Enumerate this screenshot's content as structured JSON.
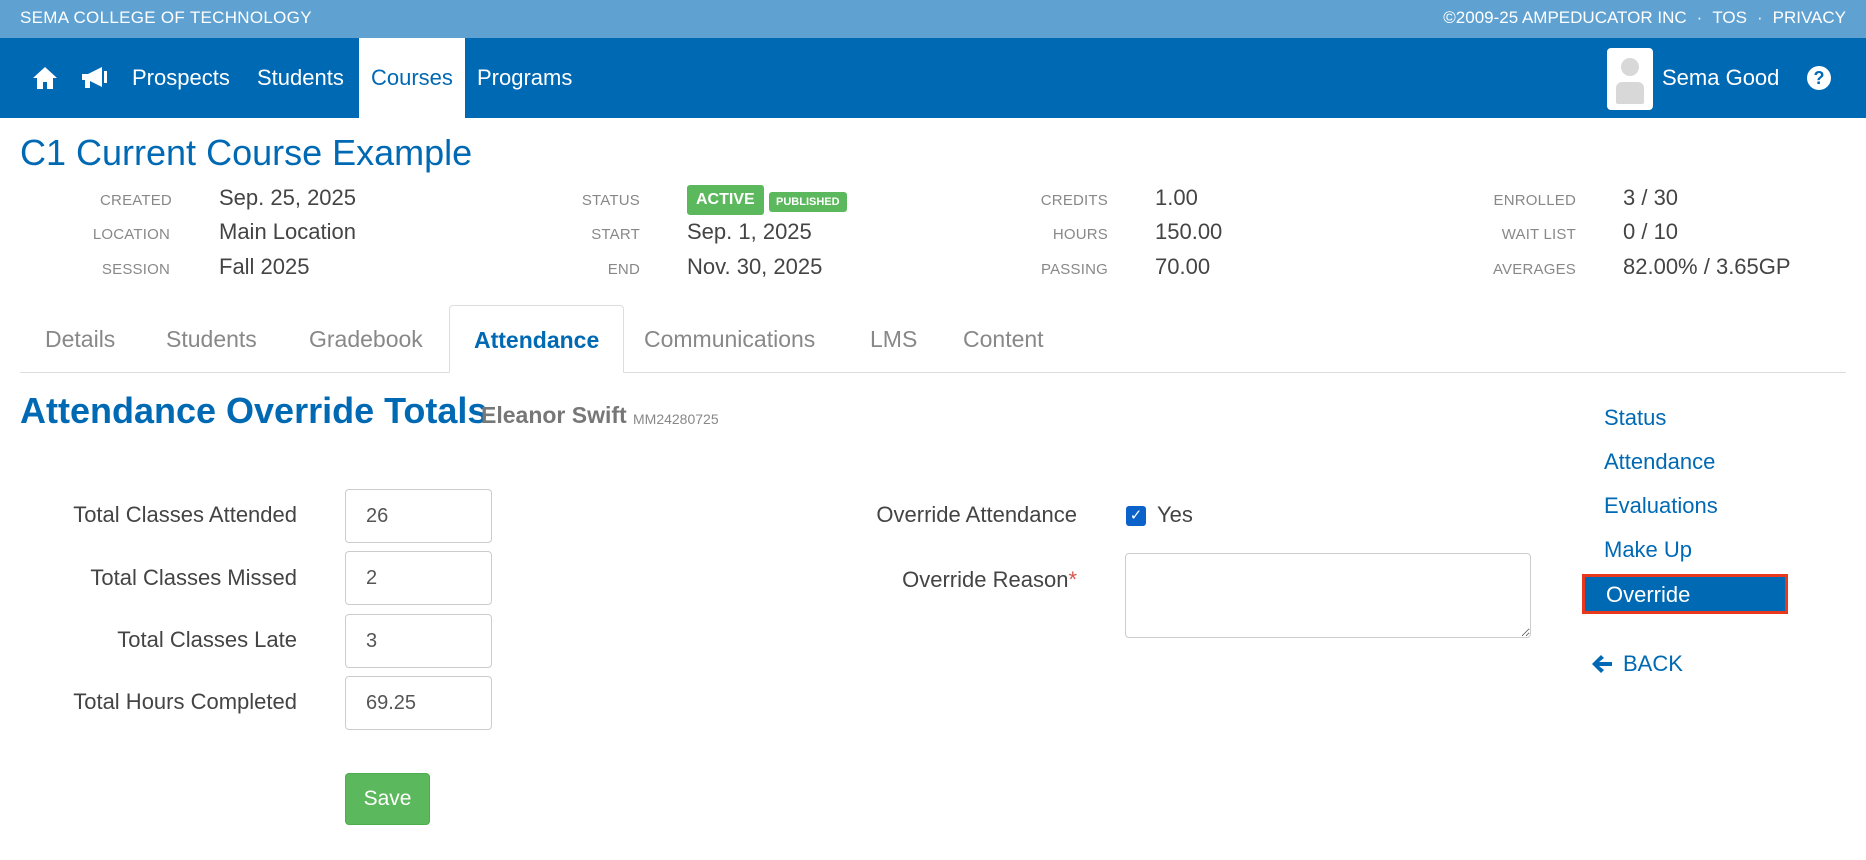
{
  "topbar": {
    "school": "SEMA COLLEGE OF TECHNOLOGY",
    "copyright": "©2009-25 AMPEDUCATOR INC",
    "separator": "·",
    "tos": "TOS",
    "privacy": "PRIVACY"
  },
  "nav": {
    "items": [
      "Prospects",
      "Students",
      "Courses",
      "Programs"
    ],
    "active": "Courses",
    "user_name": "Sema Good",
    "help": "?"
  },
  "course": {
    "title": "C1 Current Course Example",
    "created_label": "CREATED",
    "created": "Sep. 25, 2025",
    "location_label": "LOCATION",
    "location": "Main Location",
    "session_label": "SESSION",
    "session": "Fall 2025",
    "status_label": "STATUS",
    "status": "ACTIVE",
    "published": "PUBLISHED",
    "start_label": "START",
    "start": "Sep. 1, 2025",
    "end_label": "END",
    "end": "Nov. 30, 2025",
    "credits_label": "CREDITS",
    "credits": "1.00",
    "hours_label": "HOURS",
    "hours": "150.00",
    "passing_label": "PASSING",
    "passing": "70.00",
    "enrolled_label": "ENROLLED",
    "enrolled": "3 / 30",
    "waitlist_label": "WAIT LIST",
    "waitlist": "0 / 10",
    "averages_label": "AVERAGES",
    "averages": "82.00% / 3.65GP"
  },
  "tabs": [
    "Details",
    "Students",
    "Gradebook",
    "Attendance",
    "Communications",
    "LMS",
    "Content"
  ],
  "active_tab": "Attendance",
  "section": {
    "title": "Attendance Override Totals",
    "student_name": "Eleanor Swift",
    "student_id": "MM24280725"
  },
  "form": {
    "attended_label": "Total Classes Attended",
    "attended": "26",
    "missed_label": "Total Classes Missed",
    "missed": "2",
    "late_label": "Total Classes Late",
    "late": "3",
    "hours_label": "Total Hours Completed",
    "hours": "69.25",
    "override_label": "Override Attendance",
    "override_checked": true,
    "override_yes": "Yes",
    "reason_label": "Override Reason",
    "reason_required": "*",
    "reason": "",
    "save": "Save"
  },
  "side_menu": {
    "items": [
      "Status",
      "Attendance",
      "Evaluations",
      "Make Up",
      "Override"
    ],
    "active": "Override",
    "back": "BACK"
  },
  "colors": {
    "primary": "#0069b4",
    "topbar": "#5fa2d2",
    "success": "#5cb85c",
    "highlight_border": "#e8391d"
  }
}
